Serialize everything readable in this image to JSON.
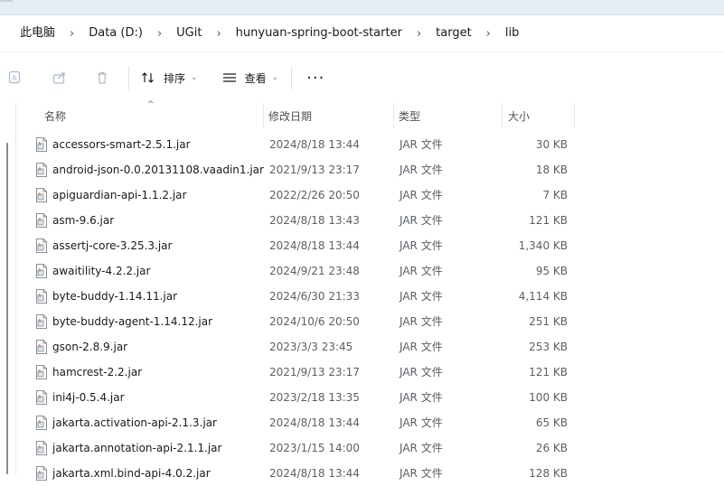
{
  "breadcrumb": [
    "此电脑",
    "Data (D:)",
    "UGit",
    "hunyuan-spring-boot-starter",
    "target",
    "lib"
  ],
  "toolbar": {
    "icons": [
      "translate-icon",
      "share-icon",
      "delete-icon"
    ],
    "sort_label": "排序",
    "view_label": "查看",
    "more_label": "···"
  },
  "columns": {
    "name": "名称",
    "date": "修改日期",
    "type": "类型",
    "size": "大小"
  },
  "files": [
    {
      "name": "accessors-smart-2.5.1.jar",
      "date": "2024/8/18 13:44",
      "type": "JAR 文件",
      "size": "30 KB"
    },
    {
      "name": "android-json-0.0.20131108.vaadin1.jar",
      "date": "2021/9/13 23:17",
      "type": "JAR 文件",
      "size": "18 KB"
    },
    {
      "name": "apiguardian-api-1.1.2.jar",
      "date": "2022/2/26 20:50",
      "type": "JAR 文件",
      "size": "7 KB"
    },
    {
      "name": "asm-9.6.jar",
      "date": "2024/8/18 13:43",
      "type": "JAR 文件",
      "size": "121 KB"
    },
    {
      "name": "assertj-core-3.25.3.jar",
      "date": "2024/8/18 13:44",
      "type": "JAR 文件",
      "size": "1,340 KB"
    },
    {
      "name": "awaitility-4.2.2.jar",
      "date": "2024/9/21 23:48",
      "type": "JAR 文件",
      "size": "95 KB"
    },
    {
      "name": "byte-buddy-1.14.11.jar",
      "date": "2024/6/30 21:33",
      "type": "JAR 文件",
      "size": "4,114 KB"
    },
    {
      "name": "byte-buddy-agent-1.14.12.jar",
      "date": "2024/10/6 20:50",
      "type": "JAR 文件",
      "size": "251 KB"
    },
    {
      "name": "gson-2.8.9.jar",
      "date": "2023/3/3 23:45",
      "type": "JAR 文件",
      "size": "253 KB"
    },
    {
      "name": "hamcrest-2.2.jar",
      "date": "2021/9/13 23:17",
      "type": "JAR 文件",
      "size": "121 KB"
    },
    {
      "name": "ini4j-0.5.4.jar",
      "date": "2023/2/18 13:35",
      "type": "JAR 文件",
      "size": "100 KB"
    },
    {
      "name": "jakarta.activation-api-2.1.3.jar",
      "date": "2024/8/18 13:44",
      "type": "JAR 文件",
      "size": "65 KB"
    },
    {
      "name": "jakarta.annotation-api-2.1.1.jar",
      "date": "2023/1/15 14:00",
      "type": "JAR 文件",
      "size": "26 KB"
    },
    {
      "name": "jakarta.xml.bind-api-4.0.2.jar",
      "date": "2024/8/18 13:44",
      "type": "JAR 文件",
      "size": "128 KB"
    }
  ]
}
